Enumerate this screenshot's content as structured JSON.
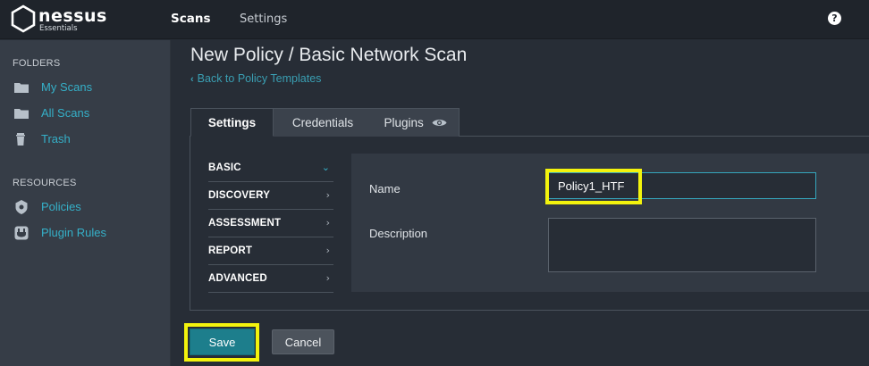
{
  "brand": {
    "name": "nessus",
    "edition": "Essentials"
  },
  "topnav": {
    "scans": "Scans",
    "settings": "Settings",
    "help_glyph": "?"
  },
  "sidebar": {
    "folders_heading": "FOLDERS",
    "folders": [
      {
        "label": "My Scans",
        "icon": "folder-icon"
      },
      {
        "label": "All Scans",
        "icon": "folder-icon"
      },
      {
        "label": "Trash",
        "icon": "trash-icon"
      }
    ],
    "resources_heading": "RESOURCES",
    "resources": [
      {
        "label": "Policies",
        "icon": "shield-icon"
      },
      {
        "label": "Plugin Rules",
        "icon": "plug-icon"
      }
    ]
  },
  "page": {
    "title": "New Policy / Basic Network Scan",
    "back_link": "Back to Policy Templates"
  },
  "tabs": [
    {
      "label": "Settings",
      "active": true
    },
    {
      "label": "Credentials",
      "active": false
    },
    {
      "label": "Plugins",
      "active": false,
      "icon": "eye-icon"
    }
  ],
  "sections": [
    {
      "label": "BASIC",
      "expanded": true
    },
    {
      "label": "DISCOVERY",
      "expanded": false
    },
    {
      "label": "ASSESSMENT",
      "expanded": false
    },
    {
      "label": "REPORT",
      "expanded": false
    },
    {
      "label": "ADVANCED",
      "expanded": false
    }
  ],
  "form": {
    "name_label": "Name",
    "name_value": "Policy1_HTF",
    "description_label": "Description",
    "description_value": ""
  },
  "buttons": {
    "save": "Save",
    "cancel": "Cancel"
  },
  "colors": {
    "accent": "#35b0c8",
    "save_button": "#1d7e8c",
    "highlight": "#f3f30d",
    "topbar": "#1f242b",
    "sidebar": "#363d47"
  }
}
